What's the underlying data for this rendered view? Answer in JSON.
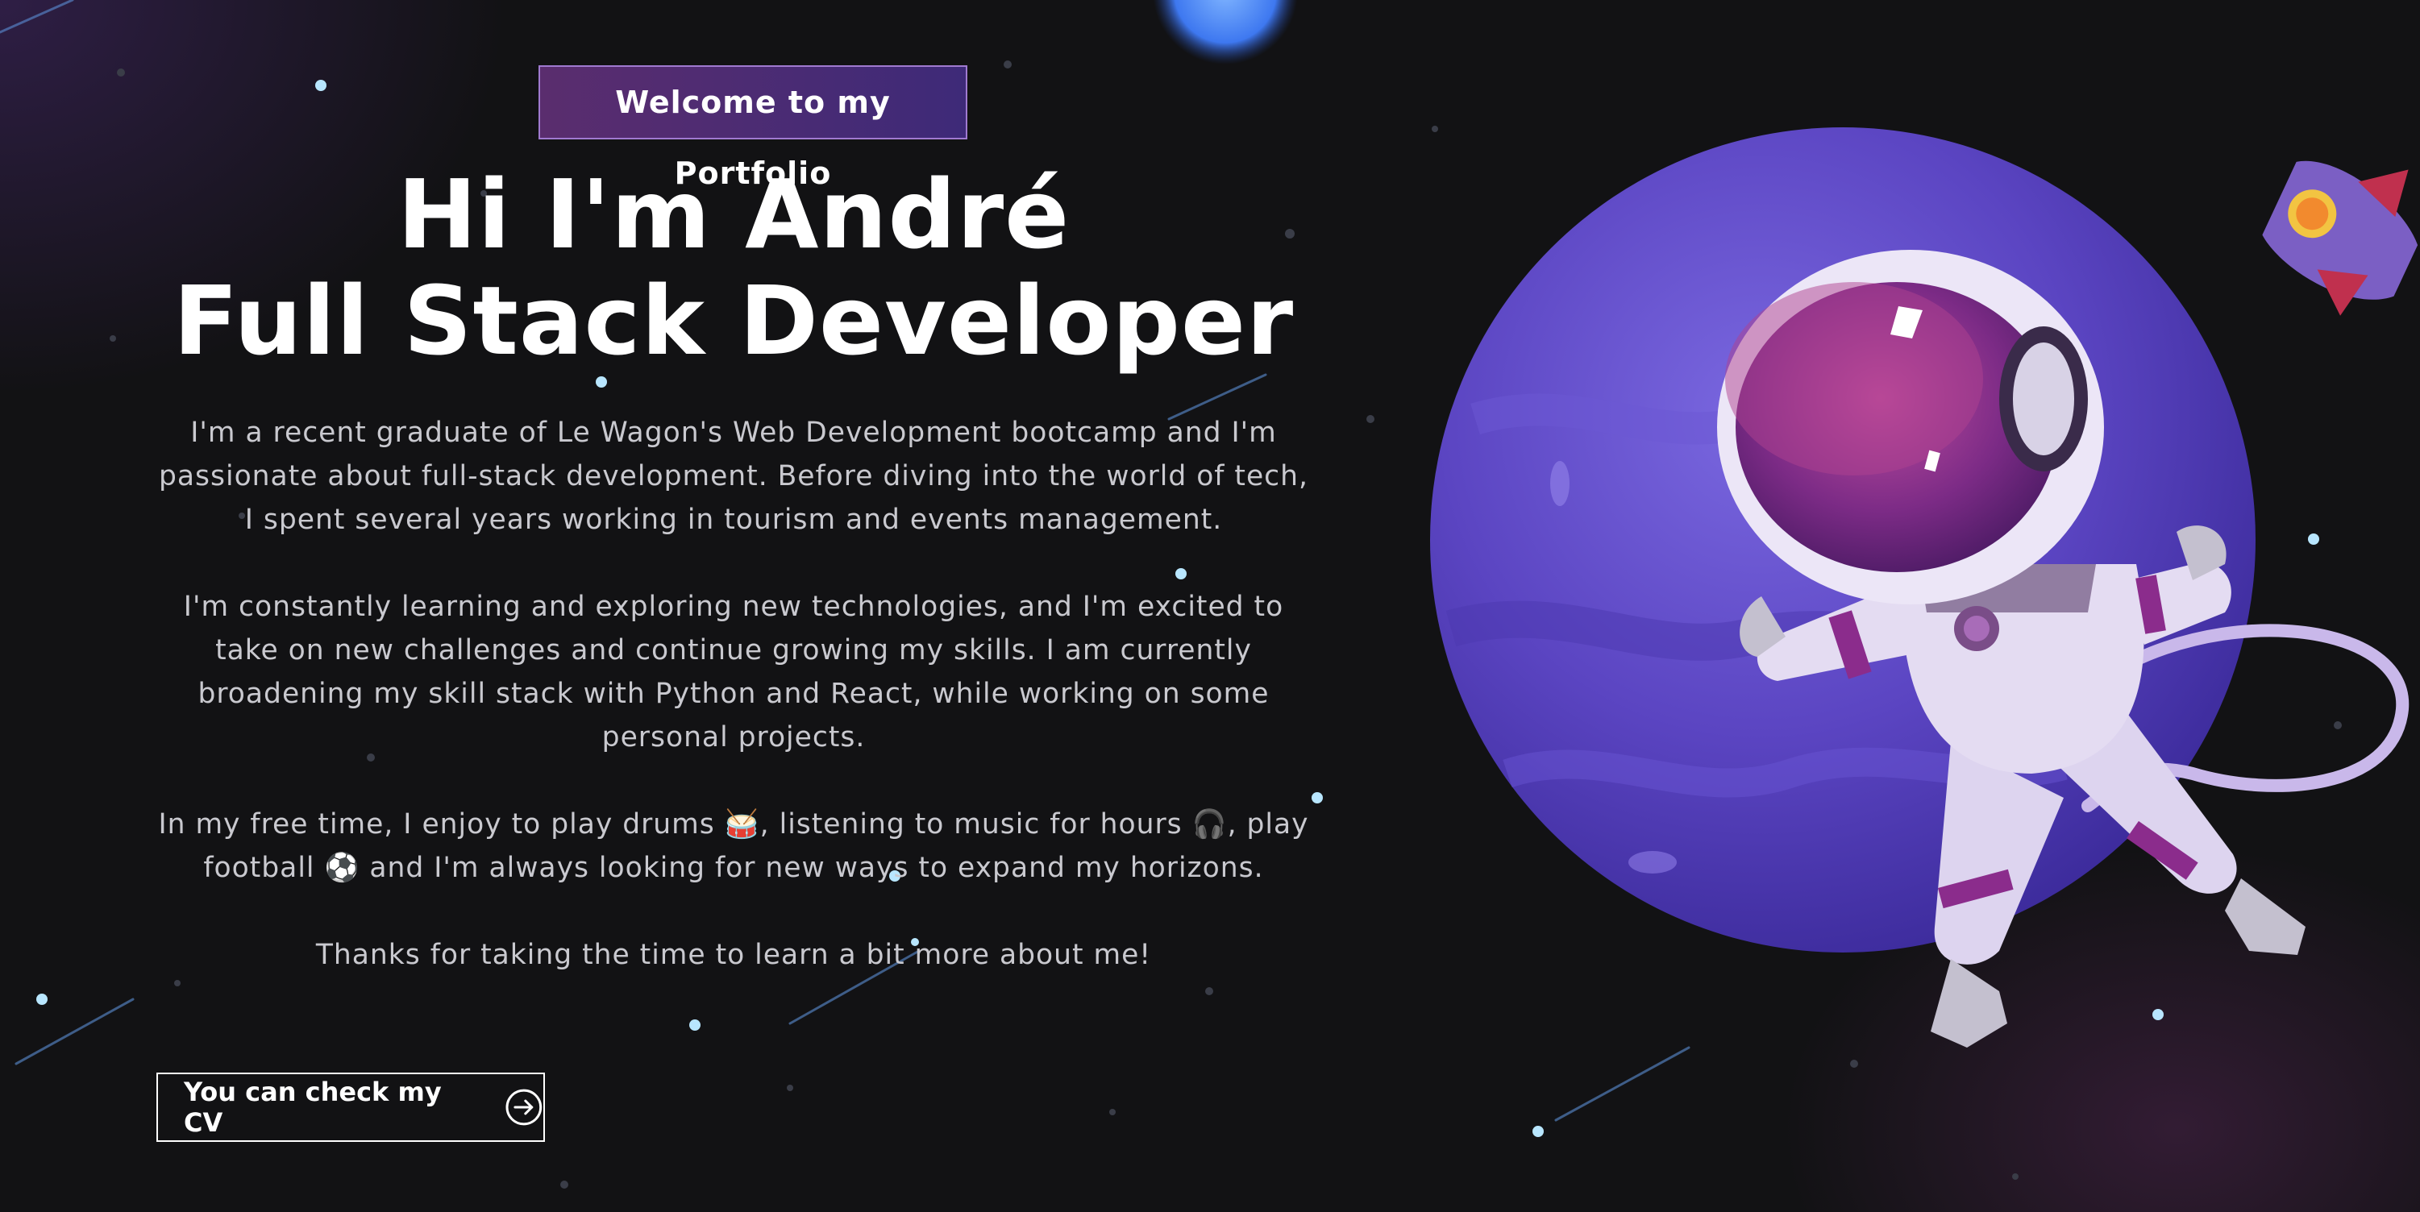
{
  "hero": {
    "badge": "Welcome to my Portfolio",
    "headline_line1": "Hi I'm André",
    "headline_line2": "Full Stack Developer",
    "bio": {
      "p1": [
        "I'm a recent graduate of Le Wagon's Web Development bootcamp and I'm",
        "passionate about full-stack development. Before diving into the world of tech,",
        "I spent several years working in tourism and events management."
      ],
      "p2": [
        "I'm constantly learning and exploring new technologies, and I'm excited to",
        "take on new challenges and continue growing my skills. I am currently",
        "broadening my skill stack with Python and React, while working on some",
        "personal projects."
      ],
      "p3": [
        "In my free time, I enjoy to play drums 🥁, listening to music for hours 🎧, play",
        "football ⚽ and I'm always looking for new ways to expand my horizons."
      ],
      "p4": "Thanks for taking the time to learn a bit more about me!"
    },
    "cv_button_label": "You can check my CV"
  },
  "icons": {
    "cv_button_icon": "arrow-right-circle-icon",
    "illustration": "astronaut-on-planet",
    "rocket": "rocket-icon"
  },
  "colors": {
    "background": "#121214",
    "badge_gradient_start": "#5a2d6e",
    "badge_gradient_end": "#3e2a78",
    "badge_border": "#a07ad0",
    "headline": "#ffffff",
    "body_text": "#c9c9cf",
    "planet": "#5b45c2",
    "astronaut_accent": "#8b2c8c"
  }
}
